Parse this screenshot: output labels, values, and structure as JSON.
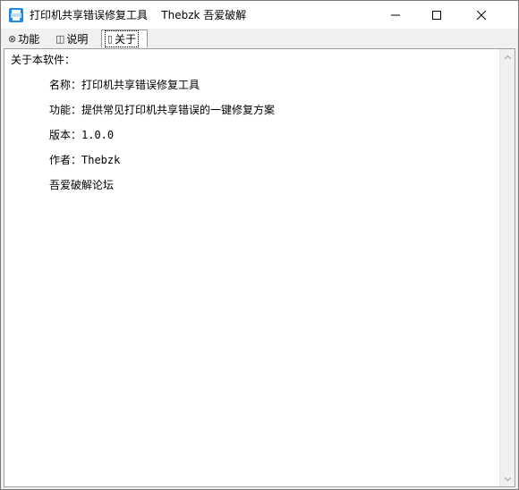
{
  "window": {
    "title": "打印机共享错误修复工具    Thebzk 吾爱破解",
    "icon": "printer-app-icon",
    "controls": [
      "minimize-icon",
      "maximize-icon",
      "close-icon"
    ]
  },
  "tabs": [
    {
      "icon": "⊗",
      "label": "功能"
    },
    {
      "icon": "◫",
      "label": "说明"
    },
    {
      "icon": "▯",
      "label": "关于",
      "selected": true
    }
  ],
  "about": {
    "lines": [
      "关于本软件：",
      "名称：打印机共享错误修复工具",
      "功能：提供常见打印机共享错误的一键修复方案",
      "版本：1.0.0",
      "作者：Thebzk",
      "吾爱破解论坛"
    ]
  },
  "colors": {
    "accent": "#1e88e5",
    "border": "#7a7a7a",
    "background": "#f0f0f0"
  }
}
